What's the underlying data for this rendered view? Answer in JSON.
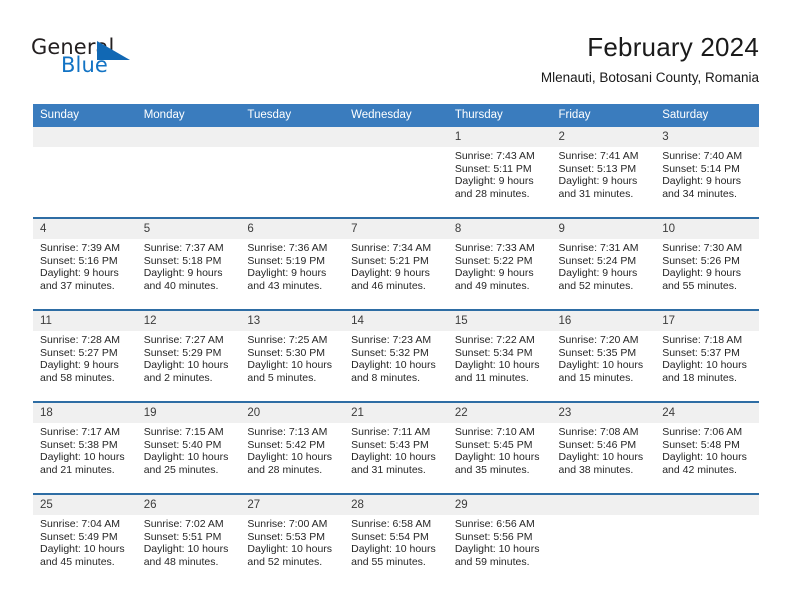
{
  "brand": {
    "name_top": "General",
    "name_bottom": "Blue",
    "accent_color": "#1168b4",
    "text_color": "#231f20"
  },
  "header": {
    "title": "February 2024",
    "subtitle": "Mlenauti, Botosani County, Romania"
  },
  "theme": {
    "header_row_bg": "#3a7cbe",
    "row_border": "#2e6da4",
    "daynum_bg": "#f0f0f0"
  },
  "calendar": {
    "weekday_headers": [
      "Sunday",
      "Monday",
      "Tuesday",
      "Wednesday",
      "Thursday",
      "Friday",
      "Saturday"
    ],
    "weeks": [
      [
        {
          "day": "",
          "details": ""
        },
        {
          "day": "",
          "details": ""
        },
        {
          "day": "",
          "details": ""
        },
        {
          "day": "",
          "details": ""
        },
        {
          "day": "1",
          "details": "Sunrise: 7:43 AM\nSunset: 5:11 PM\nDaylight: 9 hours\nand 28 minutes."
        },
        {
          "day": "2",
          "details": "Sunrise: 7:41 AM\nSunset: 5:13 PM\nDaylight: 9 hours\nand 31 minutes."
        },
        {
          "day": "3",
          "details": "Sunrise: 7:40 AM\nSunset: 5:14 PM\nDaylight: 9 hours\nand 34 minutes."
        }
      ],
      [
        {
          "day": "4",
          "details": "Sunrise: 7:39 AM\nSunset: 5:16 PM\nDaylight: 9 hours\nand 37 minutes."
        },
        {
          "day": "5",
          "details": "Sunrise: 7:37 AM\nSunset: 5:18 PM\nDaylight: 9 hours\nand 40 minutes."
        },
        {
          "day": "6",
          "details": "Sunrise: 7:36 AM\nSunset: 5:19 PM\nDaylight: 9 hours\nand 43 minutes."
        },
        {
          "day": "7",
          "details": "Sunrise: 7:34 AM\nSunset: 5:21 PM\nDaylight: 9 hours\nand 46 minutes."
        },
        {
          "day": "8",
          "details": "Sunrise: 7:33 AM\nSunset: 5:22 PM\nDaylight: 9 hours\nand 49 minutes."
        },
        {
          "day": "9",
          "details": "Sunrise: 7:31 AM\nSunset: 5:24 PM\nDaylight: 9 hours\nand 52 minutes."
        },
        {
          "day": "10",
          "details": "Sunrise: 7:30 AM\nSunset: 5:26 PM\nDaylight: 9 hours\nand 55 minutes."
        }
      ],
      [
        {
          "day": "11",
          "details": "Sunrise: 7:28 AM\nSunset: 5:27 PM\nDaylight: 9 hours\nand 58 minutes."
        },
        {
          "day": "12",
          "details": "Sunrise: 7:27 AM\nSunset: 5:29 PM\nDaylight: 10 hours\nand 2 minutes."
        },
        {
          "day": "13",
          "details": "Sunrise: 7:25 AM\nSunset: 5:30 PM\nDaylight: 10 hours\nand 5 minutes."
        },
        {
          "day": "14",
          "details": "Sunrise: 7:23 AM\nSunset: 5:32 PM\nDaylight: 10 hours\nand 8 minutes."
        },
        {
          "day": "15",
          "details": "Sunrise: 7:22 AM\nSunset: 5:34 PM\nDaylight: 10 hours\nand 11 minutes."
        },
        {
          "day": "16",
          "details": "Sunrise: 7:20 AM\nSunset: 5:35 PM\nDaylight: 10 hours\nand 15 minutes."
        },
        {
          "day": "17",
          "details": "Sunrise: 7:18 AM\nSunset: 5:37 PM\nDaylight: 10 hours\nand 18 minutes."
        }
      ],
      [
        {
          "day": "18",
          "details": "Sunrise: 7:17 AM\nSunset: 5:38 PM\nDaylight: 10 hours\nand 21 minutes."
        },
        {
          "day": "19",
          "details": "Sunrise: 7:15 AM\nSunset: 5:40 PM\nDaylight: 10 hours\nand 25 minutes."
        },
        {
          "day": "20",
          "details": "Sunrise: 7:13 AM\nSunset: 5:42 PM\nDaylight: 10 hours\nand 28 minutes."
        },
        {
          "day": "21",
          "details": "Sunrise: 7:11 AM\nSunset: 5:43 PM\nDaylight: 10 hours\nand 31 minutes."
        },
        {
          "day": "22",
          "details": "Sunrise: 7:10 AM\nSunset: 5:45 PM\nDaylight: 10 hours\nand 35 minutes."
        },
        {
          "day": "23",
          "details": "Sunrise: 7:08 AM\nSunset: 5:46 PM\nDaylight: 10 hours\nand 38 minutes."
        },
        {
          "day": "24",
          "details": "Sunrise: 7:06 AM\nSunset: 5:48 PM\nDaylight: 10 hours\nand 42 minutes."
        }
      ],
      [
        {
          "day": "25",
          "details": "Sunrise: 7:04 AM\nSunset: 5:49 PM\nDaylight: 10 hours\nand 45 minutes."
        },
        {
          "day": "26",
          "details": "Sunrise: 7:02 AM\nSunset: 5:51 PM\nDaylight: 10 hours\nand 48 minutes."
        },
        {
          "day": "27",
          "details": "Sunrise: 7:00 AM\nSunset: 5:53 PM\nDaylight: 10 hours\nand 52 minutes."
        },
        {
          "day": "28",
          "details": "Sunrise: 6:58 AM\nSunset: 5:54 PM\nDaylight: 10 hours\nand 55 minutes."
        },
        {
          "day": "29",
          "details": "Sunrise: 6:56 AM\nSunset: 5:56 PM\nDaylight: 10 hours\nand 59 minutes."
        },
        {
          "day": "",
          "details": ""
        },
        {
          "day": "",
          "details": ""
        }
      ]
    ]
  }
}
